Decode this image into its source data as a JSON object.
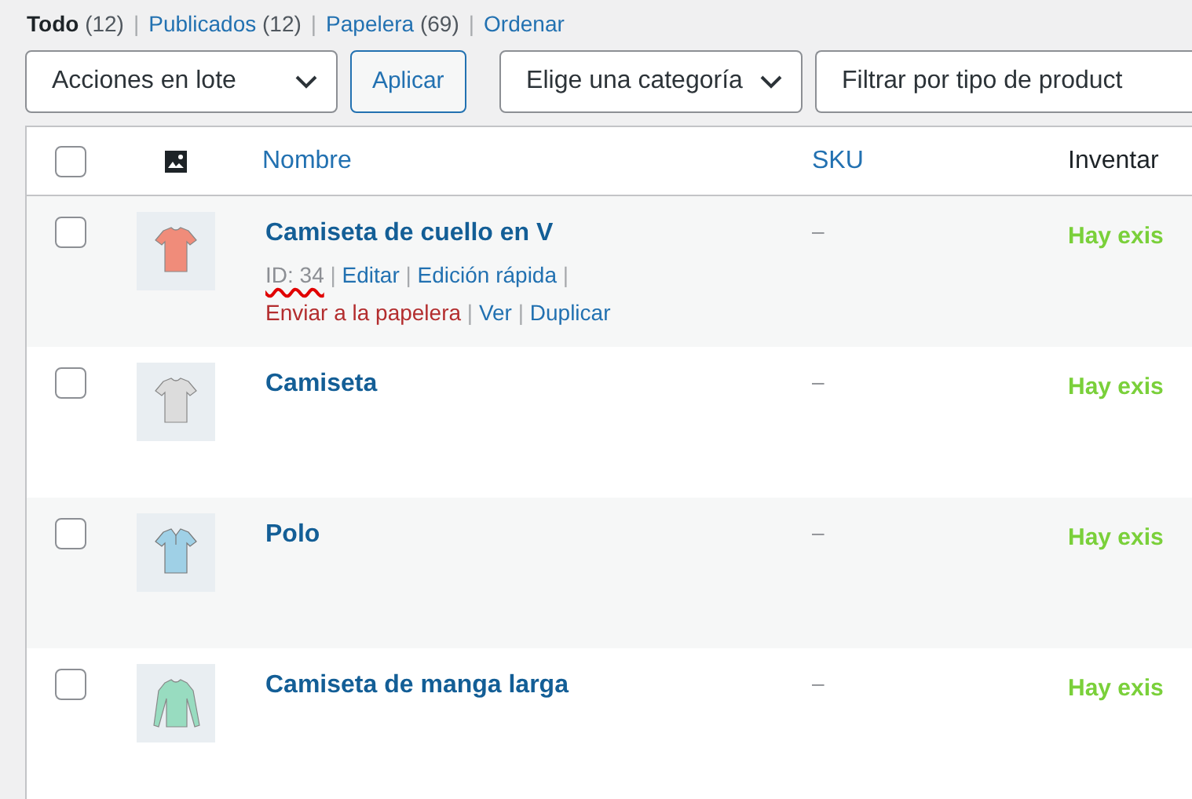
{
  "views": [
    {
      "label": "Todo",
      "count": "(12)",
      "selected": true
    },
    {
      "label": "Publicados",
      "count": "(12)",
      "selected": false
    },
    {
      "label": "Papelera",
      "count": "(69)",
      "selected": false
    },
    {
      "label": "Ordenar",
      "selected": false
    }
  ],
  "separator": "|",
  "toolbar": {
    "bulk_actions": "Acciones en lote",
    "apply": "Aplicar",
    "category": "Elige una categoría",
    "product_type": "Filtrar por tipo de product"
  },
  "table": {
    "select_all_checked": false,
    "columns": [
      {
        "label": "Nombre",
        "sortable": true
      },
      {
        "label": "SKU",
        "sortable": true
      },
      {
        "label": "Inventar",
        "sortable": false
      }
    ],
    "rows": [
      {
        "name": "Camiseta de cuello en V",
        "sku": "–",
        "stock": "Hay exis",
        "checked": false,
        "kind": "tshirt",
        "color": "#f08c7a",
        "actions": [
          {
            "text": "ID: 34",
            "kind": "id",
            "marked": true
          },
          {
            "text": "Editar",
            "kind": "link",
            "marked": false
          },
          {
            "text": "Edición rápida",
            "kind": "link",
            "marked": false
          },
          {
            "text": "Enviar a la papelera",
            "kind": "delete",
            "marked": false
          },
          {
            "text": "Ver",
            "kind": "link",
            "marked": false
          },
          {
            "text": "Duplicar",
            "kind": "link",
            "marked": false
          }
        ]
      },
      {
        "name": "Camiseta",
        "sku": "–",
        "stock": "Hay exis",
        "checked": false,
        "kind": "tshirt",
        "color": "#dcdcdc"
      },
      {
        "name": "Polo",
        "sku": "–",
        "stock": "Hay exis",
        "checked": false,
        "kind": "polo",
        "color": "#9fd0e6"
      },
      {
        "name": "Camiseta de manga larga",
        "sku": "–",
        "stock": "Hay exis",
        "checked": false,
        "kind": "longsleeve",
        "color": "#98dcc0"
      }
    ]
  }
}
